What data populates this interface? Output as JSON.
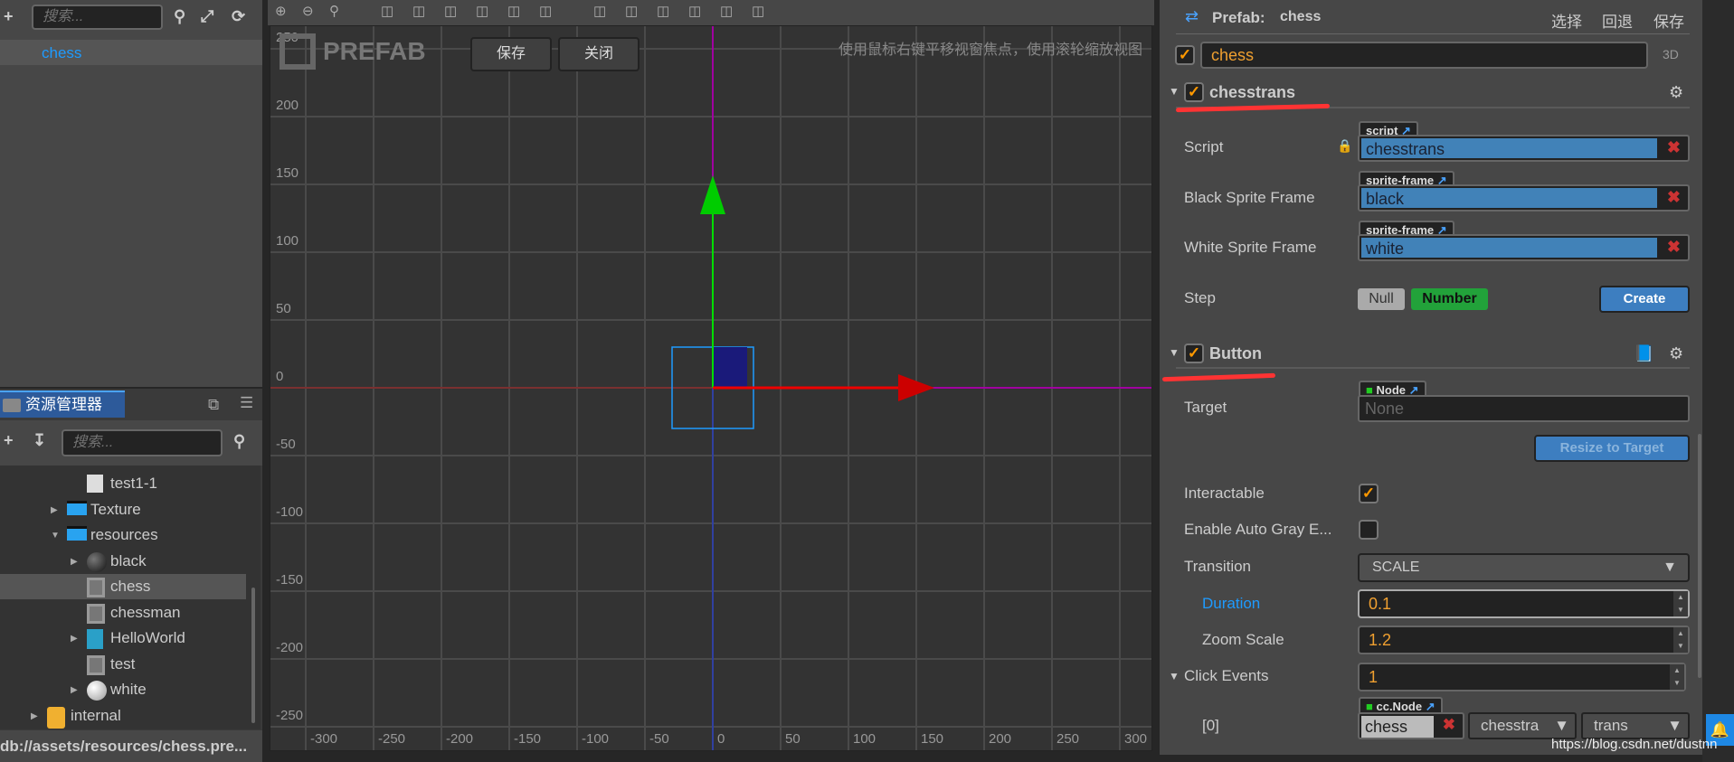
{
  "hierarchy": {
    "search_placeholder": "搜索...",
    "items": [
      {
        "label": "chess"
      }
    ]
  },
  "assets": {
    "tab": "资源管理器",
    "search_placeholder": "搜索...",
    "status_path": "db://assets/resources/chess.pre...",
    "items": [
      {
        "label": "test1-1",
        "icon": "js-file-icon"
      },
      {
        "label": "Texture",
        "icon": "folder-icon"
      },
      {
        "label": "resources",
        "icon": "folder-icon"
      },
      {
        "label": "black",
        "icon": "black-sphere-icon"
      },
      {
        "label": "chess",
        "icon": "prefab-icon"
      },
      {
        "label": "chessman",
        "icon": "prefab-icon"
      },
      {
        "label": "HelloWorld",
        "icon": "scene-icon"
      },
      {
        "label": "test",
        "icon": "prefab-icon"
      },
      {
        "label": "white",
        "icon": "white-sphere-icon"
      },
      {
        "label": "internal",
        "icon": "db-icon"
      }
    ]
  },
  "scene": {
    "logo": "PREFAB",
    "save": "保存",
    "close": "关闭",
    "hint": "使用鼠标右键平移视窗焦点，使用滚轮缩放视图",
    "x_ticks": [
      "-300",
      "-250",
      "-200",
      "-150",
      "-100",
      "-50",
      "0",
      "50",
      "100",
      "150",
      "200",
      "250",
      "300"
    ],
    "y_ticks": [
      "250",
      "200",
      "150",
      "100",
      "50",
      "0",
      "-50",
      "-100",
      "-150",
      "-200",
      "-250"
    ]
  },
  "inspector": {
    "prefab_label": "Prefab:",
    "prefab_name": "chess",
    "select": "选择",
    "revert": "回退",
    "save": "保存",
    "node_name": "chess",
    "mode": "3D",
    "comp1": {
      "title": "chesstrans",
      "script_label": "Script",
      "script_tag": "script",
      "script_value": "chesstrans",
      "black_label": "Black Sprite Frame",
      "black_tag": "sprite-frame",
      "black_value": "black",
      "white_label": "White Sprite Frame",
      "white_tag": "sprite-frame",
      "white_value": "white",
      "step_label": "Step",
      "null": "Null",
      "number": "Number",
      "create": "Create"
    },
    "comp2": {
      "title": "Button",
      "target_label": "Target",
      "target_tag": "Node",
      "target_value": "None",
      "resize": "Resize to Target",
      "interactable_label": "Interactable",
      "autogray_label": "Enable Auto Gray E...",
      "transition_label": "Transition",
      "transition_value": "SCALE",
      "duration_label": "Duration",
      "duration_value": "0.1",
      "zoom_label": "Zoom Scale",
      "zoom_value": "1.2",
      "events_label": "Click Events",
      "events_value": "1",
      "event0_label": "[0]",
      "event0_tag": "cc.Node",
      "event0_node": "chess",
      "event0_component": "chesstra",
      "event0_handler": "trans"
    }
  },
  "watermark": "https://blog.csdn.net/dustnn",
  "colors": {
    "accent_orange": "#f0a030",
    "asset_blue": "#4182b8",
    "selected_blue": "#1e9bff",
    "annotation_red": "#ff3333"
  }
}
